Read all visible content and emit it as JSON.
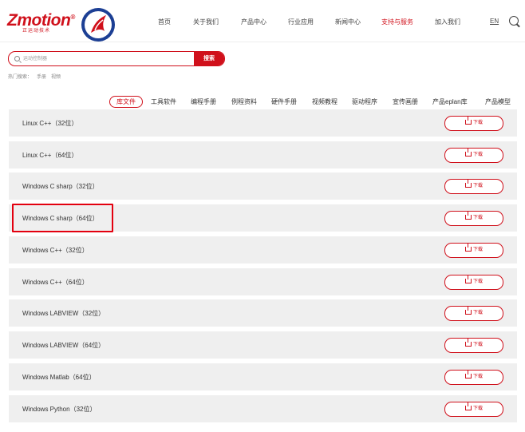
{
  "brand": {
    "name": "Zmotion",
    "registered": "®",
    "subtitle": "正运动技术"
  },
  "nav": {
    "items": [
      {
        "label": "首页"
      },
      {
        "label": "关于我们"
      },
      {
        "label": "产品中心"
      },
      {
        "label": "行业应用"
      },
      {
        "label": "新闻中心"
      },
      {
        "label": "支持与服务"
      },
      {
        "label": "加入我们"
      }
    ],
    "active_index": 5,
    "lang": "EN"
  },
  "search": {
    "placeholder": "运动控制器",
    "button": "搜索",
    "hot_label": "热门搜索：",
    "hot_terms": [
      "手册",
      "视频"
    ]
  },
  "tabs": {
    "items": [
      "库文件",
      "工具软件",
      "编程手册",
      "例程资料",
      "硬件手册",
      "视频教程",
      "驱动程序",
      "宣传画册",
      "产品eplan库",
      "产品模型"
    ],
    "active_index": 0
  },
  "downloads": {
    "button_label": "下载",
    "rows": [
      {
        "label": "Linux C++（32位）"
      },
      {
        "label": "Linux C++（64位）"
      },
      {
        "label": "Windows C sharp（32位）"
      },
      {
        "label": "Windows C sharp（64位）"
      },
      {
        "label": "Windows C++（32位）"
      },
      {
        "label": "Windows C++（64位）"
      },
      {
        "label": "Windows LABVIEW（32位）"
      },
      {
        "label": "Windows LABVIEW（64位）"
      },
      {
        "label": "Windows Matlab（64位）"
      },
      {
        "label": "Windows Python（32位）"
      }
    ],
    "highlighted_index": 3
  },
  "colors": {
    "brand_red": "#d0101b",
    "row_bg": "#efefef",
    "highlight_border": "#e3000f"
  }
}
